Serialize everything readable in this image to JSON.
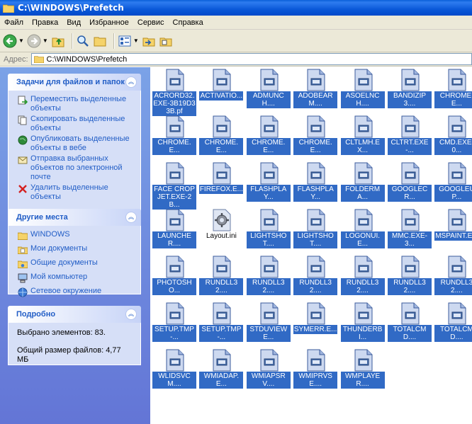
{
  "window": {
    "title": "C:\\WINDOWS\\Prefetch"
  },
  "menu": [
    "Файл",
    "Правка",
    "Вид",
    "Избранное",
    "Сервис",
    "Справка"
  ],
  "address": {
    "label": "Адрес:",
    "value": "C:\\WINDOWS\\Prefetch"
  },
  "sidebar": {
    "tasks": {
      "title": "Задачи для файлов и папок",
      "items": [
        {
          "label": "Переместить выделенные объекты",
          "icon": "move-icon"
        },
        {
          "label": "Скопировать выделенные объекты",
          "icon": "copy-icon"
        },
        {
          "label": "Опубликовать выделенные объекты в вебе",
          "icon": "publish-web-icon"
        },
        {
          "label": "Отправка выбранных объектов по электронной почте",
          "icon": "email-icon"
        },
        {
          "label": "Удалить выделенные объекты",
          "icon": "delete-icon"
        }
      ]
    },
    "places": {
      "title": "Другие места",
      "items": [
        {
          "label": "WINDOWS",
          "icon": "folder-icon"
        },
        {
          "label": "Мои документы",
          "icon": "my-documents-icon"
        },
        {
          "label": "Общие документы",
          "icon": "shared-documents-icon"
        },
        {
          "label": "Мой компьютер",
          "icon": "my-computer-icon"
        },
        {
          "label": "Сетевое окружение",
          "icon": "network-icon"
        }
      ]
    },
    "details": {
      "title": "Подробно",
      "selected": "Выбрано элементов: 83.",
      "size": "Общий размер файлов: 4,77 МБ"
    }
  },
  "files": [
    "ACRORD32.EXE-3B19D33B.pf",
    "ACTIVATIO...",
    "ADMUNCH....",
    "ADOBEARM....",
    "ASOELNCH....",
    "BANDIZIP3....",
    "CHROME.E...",
    "CHROME.E...",
    "CHROME.E...",
    "CHROME.E...",
    "CHROME.E...",
    "CLTLMH.EX...",
    "CLTRT.EXE-...",
    "CMD.EXE-0...",
    "FACE CROP JET.EXE-2B...",
    "FIREFOX.E...",
    "FLASHPLAY...",
    "FLASHPLAY...",
    "FOLDERMA...",
    "GOOGLECR...",
    "GOOGLEUP...",
    "LAUNCHER....",
    "Layout.ini",
    "LIGHTSHOT....",
    "LIGHTSHOT....",
    "LOGONUI.E...",
    "MMC.EXE-3...",
    "MSPAINT.E...",
    "PHOTOSHO...",
    "RUNDLL32....",
    "RUNDLL32....",
    "RUNDLL32....",
    "RUNDLL32....",
    "RUNDLL32....",
    "RUNDLL32....",
    "SETUP.TMP-...",
    "SETUP.TMP-...",
    "STDUVIEWE...",
    "SYMERR.E...",
    "THUNDERBI...",
    "TOTALCMD....",
    "TOTALCMD....",
    "WLIDSVCM....",
    "WMIADAP.E...",
    "WMIAPSRV....",
    "WMIPRVSE....",
    "WMPLAYER...."
  ]
}
